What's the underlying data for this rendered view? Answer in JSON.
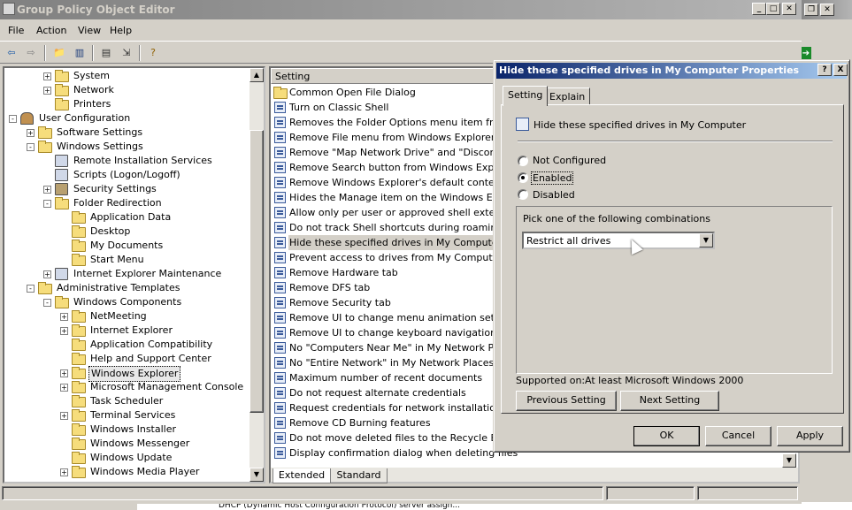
{
  "main_window": {
    "title": "Group Policy Object Editor",
    "menu": [
      "File",
      "Action",
      "View",
      "Help"
    ]
  },
  "tree": [
    {
      "label": "System",
      "level": 2,
      "expander": "+",
      "icon": "folder-icon"
    },
    {
      "label": "Network",
      "level": 2,
      "expander": "+",
      "icon": "folder-icon"
    },
    {
      "label": "Printers",
      "level": 2,
      "expander": "",
      "icon": "folder-icon"
    },
    {
      "label": "User Configuration",
      "level": 0,
      "expander": "-",
      "icon": "user-config-icon"
    },
    {
      "label": "Software Settings",
      "level": 1,
      "expander": "+",
      "icon": "folder-icon"
    },
    {
      "label": "Windows Settings",
      "level": 1,
      "expander": "-",
      "icon": "folder-icon"
    },
    {
      "label": "Remote Installation Services",
      "level": 2,
      "expander": "",
      "icon": "computer-icon"
    },
    {
      "label": "Scripts (Logon/Logoff)",
      "level": 2,
      "expander": "",
      "icon": "script-icon"
    },
    {
      "label": "Security Settings",
      "level": 2,
      "expander": "+",
      "icon": "security-icon"
    },
    {
      "label": "Folder Redirection",
      "level": 2,
      "expander": "-",
      "icon": "folder-icon"
    },
    {
      "label": "Application Data",
      "level": 3,
      "expander": "",
      "icon": "folder-icon"
    },
    {
      "label": "Desktop",
      "level": 3,
      "expander": "",
      "icon": "folder-icon"
    },
    {
      "label": "My Documents",
      "level": 3,
      "expander": "",
      "icon": "folder-icon"
    },
    {
      "label": "Start Menu",
      "level": 3,
      "expander": "",
      "icon": "folder-icon"
    },
    {
      "label": "Internet Explorer Maintenance",
      "level": 2,
      "expander": "+",
      "icon": "ie-icon"
    },
    {
      "label": "Administrative Templates",
      "level": 1,
      "expander": "-",
      "icon": "folder-icon"
    },
    {
      "label": "Windows Components",
      "level": 2,
      "expander": "-",
      "icon": "folder-icon"
    },
    {
      "label": "NetMeeting",
      "level": 3,
      "expander": "+",
      "icon": "folder-icon"
    },
    {
      "label": "Internet Explorer",
      "level": 3,
      "expander": "+",
      "icon": "folder-icon"
    },
    {
      "label": "Application Compatibility",
      "level": 3,
      "expander": "",
      "icon": "folder-icon"
    },
    {
      "label": "Help and Support Center",
      "level": 3,
      "expander": "",
      "icon": "folder-icon"
    },
    {
      "label": "Windows Explorer",
      "level": 3,
      "expander": "+",
      "icon": "folder-icon",
      "selected": true
    },
    {
      "label": "Microsoft Management Console",
      "level": 3,
      "expander": "+",
      "icon": "folder-icon"
    },
    {
      "label": "Task Scheduler",
      "level": 3,
      "expander": "",
      "icon": "folder-icon"
    },
    {
      "label": "Terminal Services",
      "level": 3,
      "expander": "+",
      "icon": "folder-icon"
    },
    {
      "label": "Windows Installer",
      "level": 3,
      "expander": "",
      "icon": "folder-icon"
    },
    {
      "label": "Windows Messenger",
      "level": 3,
      "expander": "",
      "icon": "folder-icon"
    },
    {
      "label": "Windows Update",
      "level": 3,
      "expander": "",
      "icon": "folder-icon"
    },
    {
      "label": "Windows Media Player",
      "level": 3,
      "expander": "+",
      "icon": "folder-icon"
    }
  ],
  "list": {
    "header_setting": "Setting",
    "rows": [
      {
        "label": "Common Open File Dialog",
        "icon": "folder-icon"
      },
      {
        "label": "Turn on Classic Shell",
        "icon": "policy-icon"
      },
      {
        "label": "Removes the Folder Options menu item from the",
        "icon": "policy-icon"
      },
      {
        "label": "Remove File menu from Windows Explorer",
        "icon": "policy-icon"
      },
      {
        "label": "Remove \"Map Network Drive\" and \"Disconnect Ne",
        "icon": "policy-icon"
      },
      {
        "label": "Remove Search button from Windows Explorer",
        "icon": "policy-icon"
      },
      {
        "label": "Remove Windows Explorer's default context mer",
        "icon": "policy-icon"
      },
      {
        "label": "Hides the Manage item on the Windows Explorer",
        "icon": "policy-icon"
      },
      {
        "label": "Allow only per user or approved shell extensions",
        "icon": "policy-icon"
      },
      {
        "label": "Do not track Shell shortcuts during roaming",
        "icon": "policy-icon"
      },
      {
        "label": "Hide these specified drives in My Computer",
        "icon": "policy-icon",
        "selected": true
      },
      {
        "label": "Prevent access to drives from My Computer",
        "icon": "policy-icon"
      },
      {
        "label": "Remove Hardware tab",
        "icon": "policy-icon"
      },
      {
        "label": "Remove DFS tab",
        "icon": "policy-icon"
      },
      {
        "label": "Remove Security tab",
        "icon": "policy-icon"
      },
      {
        "label": "Remove UI to change menu animation setting",
        "icon": "policy-icon"
      },
      {
        "label": "Remove UI to change keyboard navigation indica",
        "icon": "policy-icon"
      },
      {
        "label": "No \"Computers Near Me\" in My Network Places",
        "icon": "policy-icon"
      },
      {
        "label": "No \"Entire Network\" in My Network Places",
        "icon": "policy-icon"
      },
      {
        "label": "Maximum number of recent documents",
        "icon": "policy-icon"
      },
      {
        "label": "Do not request alternate credentials",
        "icon": "policy-icon"
      },
      {
        "label": "Request credentials for network installations",
        "icon": "policy-icon"
      },
      {
        "label": "Remove CD Burning features",
        "icon": "policy-icon"
      },
      {
        "label": "Do not move deleted files to the Recycle Bin",
        "icon": "policy-icon"
      },
      {
        "label": "Display confirmation dialog when deleting files",
        "icon": "policy-icon"
      }
    ],
    "tabs": [
      "Extended",
      "Standard"
    ]
  },
  "dialog": {
    "title": "Hide these specified drives in My Computer Properties",
    "title_buttons": [
      "?",
      "X"
    ],
    "tabs": [
      "Setting",
      "Explain"
    ],
    "policy_name": "Hide these specified drives in My Computer",
    "options": [
      {
        "label": "Not Configured",
        "checked": false
      },
      {
        "label": "Enabled",
        "checked": true
      },
      {
        "label": "Disabled",
        "checked": false
      }
    ],
    "group_label": "Pick one of the following combinations",
    "combo_value": "Restrict all drives",
    "supported_label": "Supported on:",
    "supported_value": "At least Microsoft Windows 2000",
    "prev_button": "Previous Setting",
    "next_button": "Next Setting",
    "ok": "OK",
    "cancel": "Cancel",
    "apply": "Apply"
  },
  "background": {
    "behind_text": "DHCP (Dynamic Host Configuration Protocol) server assign..."
  }
}
